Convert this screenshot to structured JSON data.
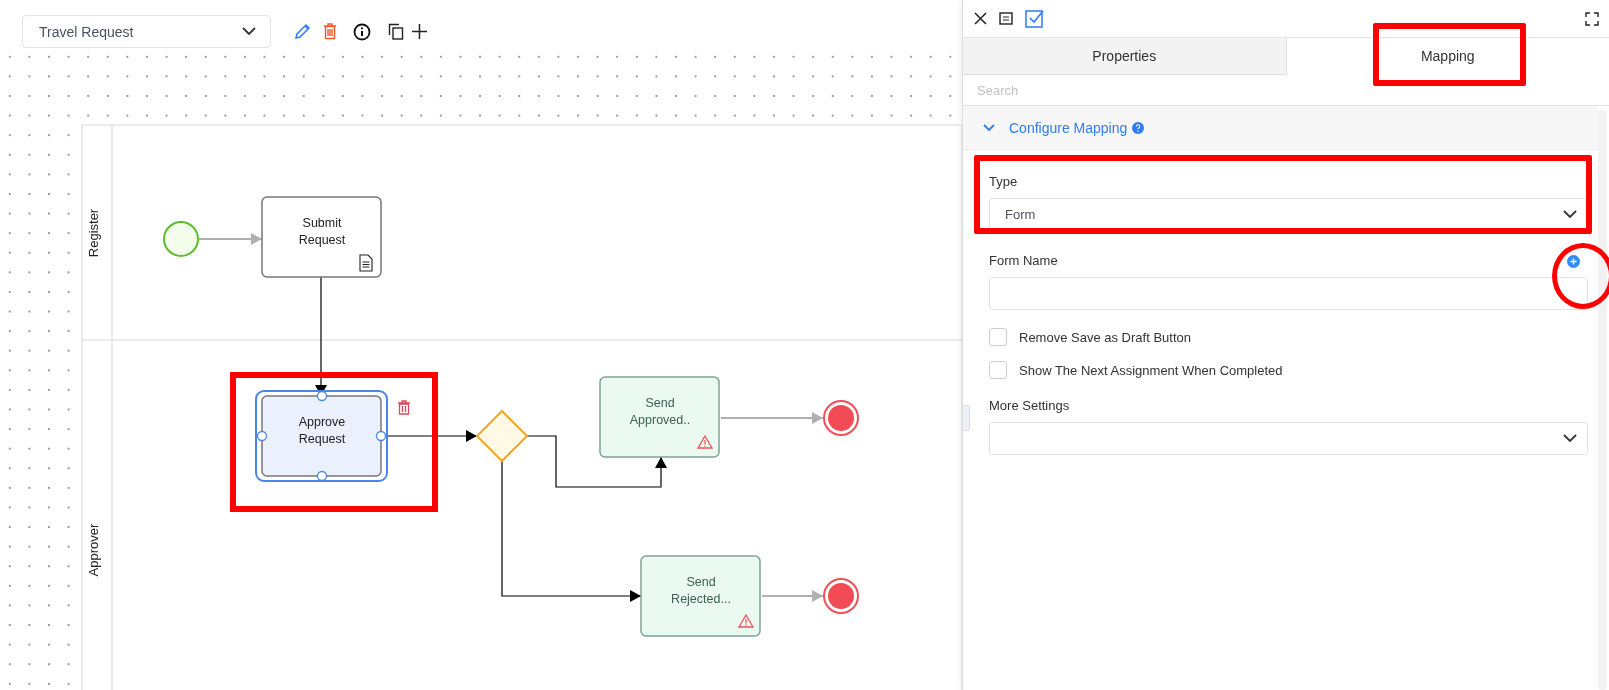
{
  "toolbar": {
    "process": "Travel Request"
  },
  "diagram": {
    "lanes": [
      {
        "label": "Register"
      },
      {
        "label": "Approver"
      }
    ],
    "nodes": [
      {
        "kind": "start"
      },
      {
        "kind": "form-task",
        "lines": [
          "Submit",
          "Request"
        ],
        "selected": false,
        "highlighted": false
      },
      {
        "kind": "task",
        "lines": [
          "Approve",
          "Request"
        ],
        "selected": true,
        "highlighted": true
      },
      {
        "kind": "gateway"
      },
      {
        "kind": "error-task",
        "lines": [
          "Send",
          "Approved.."
        ],
        "selected": false,
        "highlighted": false
      },
      {
        "kind": "end"
      },
      {
        "kind": "error-task",
        "lines": [
          "Send",
          "Rejected..."
        ],
        "selected": false,
        "highlighted": false
      },
      {
        "kind": "end"
      }
    ]
  },
  "panel": {
    "tabs": [
      {
        "label": "Properties",
        "selected": false,
        "highlighted": false
      },
      {
        "label": "Mapping",
        "selected": true,
        "highlighted": true
      }
    ],
    "search": {
      "placeholder": "Search"
    },
    "section": {
      "title": "Configure Mapping",
      "expanded": true
    },
    "fields": [
      {
        "kind": "select",
        "label": "Type",
        "value": "Form",
        "highlighted": true
      },
      {
        "kind": "text",
        "label": "Form Name",
        "add": true,
        "highlighted": true
      },
      {
        "kind": "checkbox",
        "label": "Remove Save as Draft Button",
        "checked": false
      },
      {
        "kind": "checkbox",
        "label": "Show The Next Assignment When Completed",
        "checked": false
      },
      {
        "kind": "select",
        "label": "More Settings",
        "highlighted": false
      }
    ]
  }
}
